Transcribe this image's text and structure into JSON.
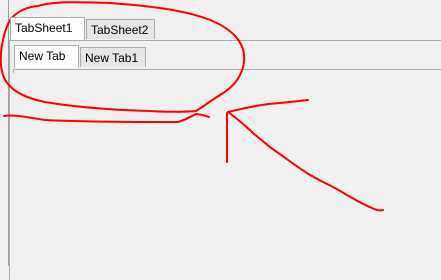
{
  "outer_tabs": [
    {
      "label": "TabSheet1",
      "active": true
    },
    {
      "label": "TabSheet2",
      "active": false
    }
  ],
  "inner_tabs": [
    {
      "label": "New Tab",
      "active": true
    },
    {
      "label": "New Tab1",
      "active": false
    }
  ],
  "colors": {
    "window_bg": "#f0f0f0",
    "tab_border": "#acacac",
    "annotation_red": "#ff0000"
  }
}
